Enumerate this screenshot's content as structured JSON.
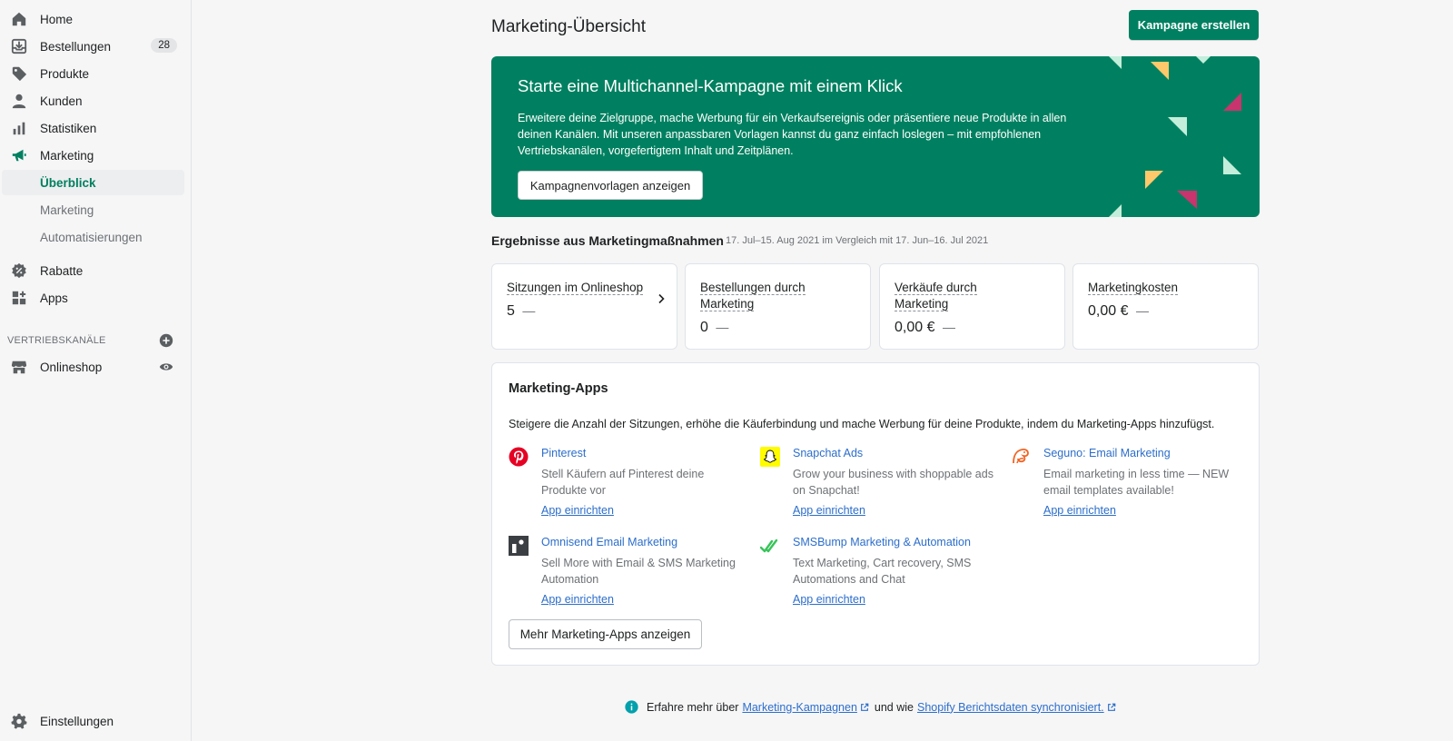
{
  "sidebar": {
    "items": [
      {
        "label": "Home",
        "icon": "home-icon"
      },
      {
        "label": "Bestellungen",
        "icon": "orders-icon",
        "badge": "28"
      },
      {
        "label": "Produkte",
        "icon": "tag-icon"
      },
      {
        "label": "Kunden",
        "icon": "person-icon"
      },
      {
        "label": "Statistiken",
        "icon": "bar-chart-icon"
      },
      {
        "label": "Marketing",
        "icon": "megaphone-icon"
      }
    ],
    "sub_items": [
      {
        "label": "Überblick",
        "active": true
      },
      {
        "label": "Marketing"
      },
      {
        "label": "Automatisierungen"
      }
    ],
    "items2": [
      {
        "label": "Rabatte",
        "icon": "discount-icon"
      },
      {
        "label": "Apps",
        "icon": "apps-icon"
      }
    ],
    "channels_title": "VERTRIEBSKANÄLE",
    "channels": [
      {
        "label": "Onlineshop",
        "icon": "store-icon"
      }
    ],
    "settings": {
      "label": "Einstellungen",
      "icon": "gear-icon"
    }
  },
  "header": {
    "title": "Marketing-Übersicht",
    "create_button": "Kampagne erstellen"
  },
  "banner": {
    "title": "Starte eine Multichannel-Kampagne mit einem Klick",
    "text": "Erweitere deine Zielgruppe, mache Werbung für ein Verkaufsereignis oder präsentiere neue Produkte in allen deinen Kanälen. Mit unseren anpassbaren Vorlagen kannst du ganz einfach loslegen – mit empfohlenen Vertriebskanälen, vorgefertigtem Inhalt und Zeitplänen.",
    "button": "Kampagnenvorlagen anzeigen"
  },
  "results": {
    "title": "Ergebnisse aus Marketingmaßnahmen",
    "range": "17. Jul–15. Aug 2021 im Vergleich mit 17. Jun–16. Jul 2021",
    "metrics": [
      {
        "label": "Sitzungen im Onlineshop",
        "value": "5",
        "delta": "—"
      },
      {
        "label": "Bestellungen durch Marketing",
        "value": "0",
        "delta": "—"
      },
      {
        "label": "Verkäufe durch Marketing",
        "value": "0,00 €",
        "delta": "—"
      },
      {
        "label": "Marketingkosten",
        "value": "0,00 €",
        "delta": "—"
      }
    ]
  },
  "apps": {
    "title": "Marketing-Apps",
    "description": "Steigere die Anzahl der Sitzungen, erhöhe die Käuferbindung und mache Werbung für deine Produkte, indem du Marketing-Apps hinzufügst.",
    "list": [
      {
        "name": "Pinterest",
        "desc": "Stell Käufern auf Pinterest deine Produkte vor",
        "link": "App einrichten",
        "icon": "pinterest-icon"
      },
      {
        "name": "Snapchat Ads",
        "desc": "Grow your business with shoppable ads on Snapchat!",
        "link": "App einrichten",
        "icon": "snapchat-icon"
      },
      {
        "name": "Seguno: Email Marketing",
        "desc": "Email marketing in less time — NEW email templates available!",
        "link": "App einrichten",
        "icon": "seguno-icon"
      },
      {
        "name": "Omnisend Email Marketing",
        "desc": "Sell More with Email & SMS Marketing Automation",
        "link": "App einrichten",
        "icon": "omnisend-icon"
      },
      {
        "name": "SMSBump Marketing & Automation",
        "desc": "Text Marketing, Cart recovery, SMS Automations and Chat",
        "link": "App einrichten",
        "icon": "smsbump-icon"
      }
    ],
    "more_button": "Mehr Marketing-Apps anzeigen"
  },
  "footer": {
    "prefix": "Erfahre mehr über",
    "link1": "Marketing-Kampagnen",
    "middle": "und wie",
    "link2": "Shopify Berichtsdaten synchronisiert."
  },
  "colors": {
    "accent": "#008060",
    "link": "#2c6ecb",
    "banner_yellow": "#ffc96b",
    "banner_red": "#c8346d",
    "banner_mint": "#c3eedb"
  }
}
